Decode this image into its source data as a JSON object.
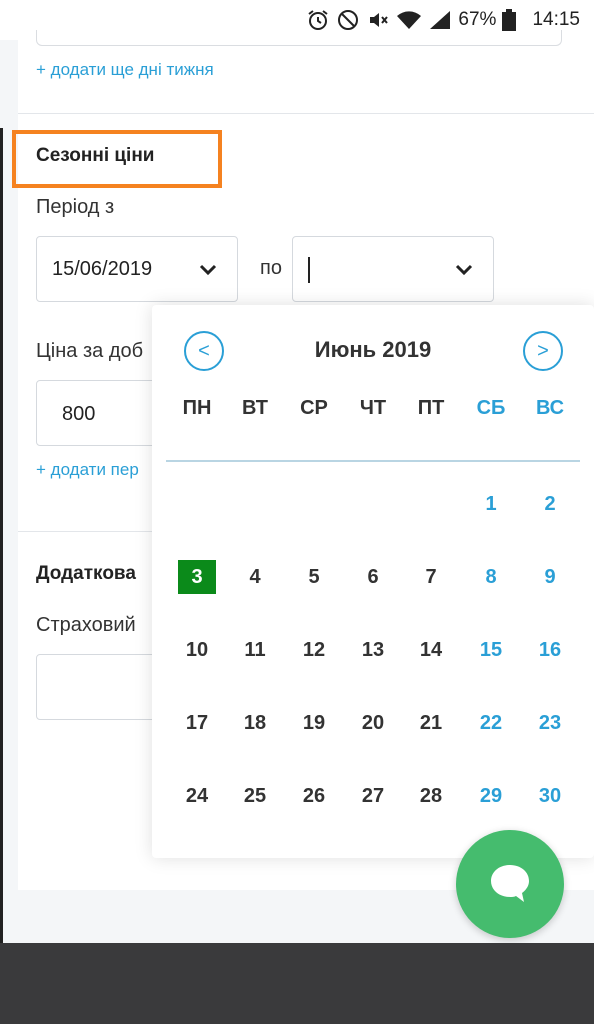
{
  "status_bar": {
    "battery": "67%",
    "time": "14:15",
    "icons": [
      "alarm-icon",
      "do-not-disturb-icon",
      "mute-icon",
      "wifi-icon",
      "signal-icon",
      "battery-icon"
    ]
  },
  "days_section": {
    "add_link": "+ додати ще дні тижня"
  },
  "seasonal": {
    "title": "Сезонні ціни",
    "period_label": "Період з",
    "date_from": "15/06/2019",
    "to_label": "по",
    "date_to": "",
    "price_label": "Ціна за доб",
    "price_value": "800",
    "add_period_link": "+ додати пер"
  },
  "additional": {
    "title": "Додаткова",
    "insurance_label": "Страховий"
  },
  "calendar": {
    "month_title": "Июнь 2019",
    "prev_label": "<",
    "next_label": ">",
    "weekdays": [
      "ПН",
      "ВТ",
      "СР",
      "ЧТ",
      "ПТ",
      "СБ",
      "ВС"
    ],
    "weeks": [
      [
        "",
        "",
        "",
        "",
        "",
        "1",
        "2"
      ],
      [
        "3",
        "4",
        "5",
        "6",
        "7",
        "8",
        "9"
      ],
      [
        "10",
        "11",
        "12",
        "13",
        "14",
        "15",
        "16"
      ],
      [
        "17",
        "18",
        "19",
        "20",
        "21",
        "22",
        "23"
      ],
      [
        "24",
        "25",
        "26",
        "27",
        "28",
        "29",
        "30"
      ]
    ],
    "selected_day": "3"
  },
  "colors": {
    "accent": "#2a9fd6",
    "selected_day": "#0b8a1a",
    "highlight_border": "#f58220",
    "chat_button": "#45bc6e"
  }
}
